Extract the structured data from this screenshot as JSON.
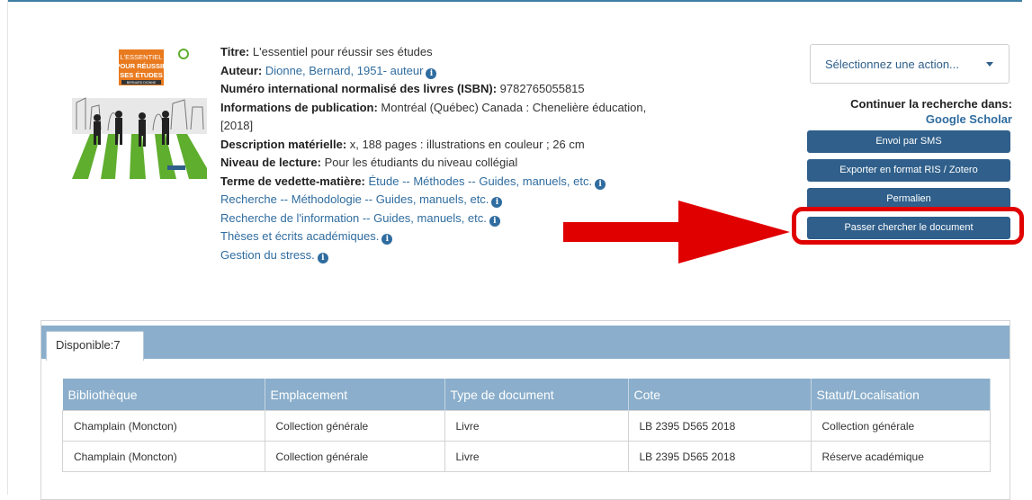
{
  "record": {
    "title_label": "Titre:",
    "title_value": "L'essentiel pour réussir ses études",
    "author_label": "Auteur:",
    "author_value": "Dionne, Bernard, 1951- auteur",
    "isbn_label": "Numéro international normalisé des livres (ISBN):",
    "isbn_value": "9782765055815",
    "pub_label": "Informations de publication:",
    "pub_value_line1": "Montréal (Québec) Canada : Chenelière éducation,",
    "pub_value_line2": "[2018]",
    "desc_label": "Description matérielle:",
    "desc_value": "x, 188 pages : illustrations en couleur ; 26 cm",
    "level_label": "Niveau de lecture:",
    "level_value": "Pour les étudiants du niveau collégial",
    "subject_label": "Terme de vedette-matière:",
    "subjects": [
      "Étude -- Méthodes -- Guides, manuels, etc.",
      "Recherche -- Méthodologie -- Guides, manuels, etc.",
      "Recherche de l'information -- Guides, manuels, etc.",
      "Thèses et écrits académiques.",
      "Gestion du stress."
    ]
  },
  "cover": {
    "line1": "L'ESSENTIEL",
    "line2": "POUR RÉUSSIR",
    "line3": "SES ÉTUDES",
    "author": "BERNARD DIONNE",
    "accent_color": "#e97a1e",
    "grass_color": "#5fae2e"
  },
  "actions": {
    "select_label": "Sélectionnez une action...",
    "continue_label": "Continuer la recherche dans:",
    "google_scholar": "Google Scholar",
    "buttons": [
      "Envoi par SMS",
      "Exporter en format RIS / Zotero",
      "Permalien",
      "Passer chercher le document"
    ]
  },
  "holdings": {
    "tab_label": "Disponible:7",
    "columns": [
      "Bibliothèque",
      "Emplacement",
      "Type de document",
      "Cote",
      "Statut/Localisation"
    ],
    "rows": [
      [
        "Champlain (Moncton)",
        "Collection générale",
        "Livre",
        "LB 2395 D565 2018",
        "Collection générale"
      ],
      [
        "Champlain (Moncton)",
        "Collection générale",
        "Livre",
        "LB 2395 D565 2018",
        "Réserve académique"
      ]
    ]
  },
  "colors": {
    "primary": "#2f5f8a",
    "link": "#2f6c9f",
    "table_header": "#8aaecb",
    "highlight": "#e00000"
  }
}
